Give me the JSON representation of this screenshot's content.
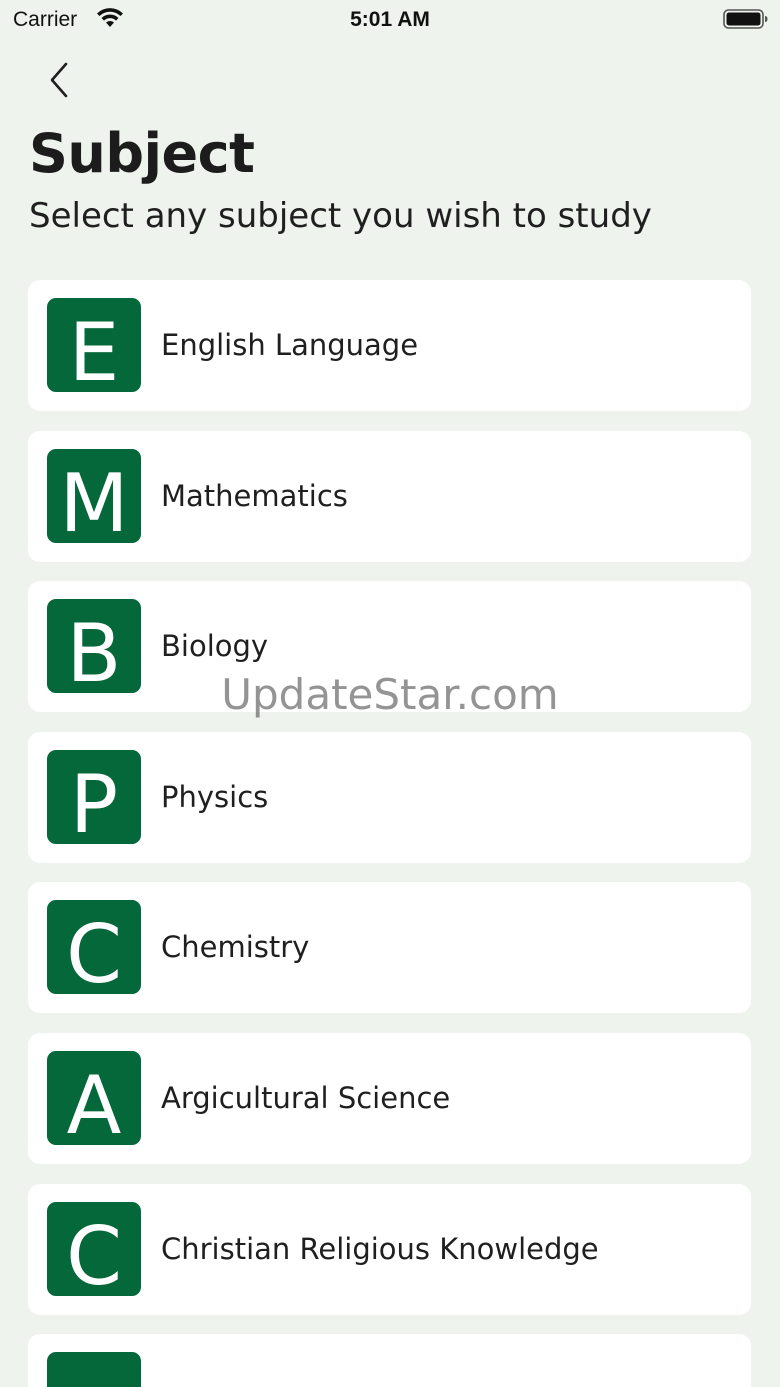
{
  "status_bar": {
    "carrier": "Carrier",
    "time": "5:01 AM"
  },
  "header": {
    "title": "Subject",
    "subtitle": "Select any subject you wish to study"
  },
  "subjects": [
    {
      "initial": "E",
      "label": "English Language"
    },
    {
      "initial": "M",
      "label": "Mathematics"
    },
    {
      "initial": "B",
      "label": "Biology"
    },
    {
      "initial": "P",
      "label": "Physics"
    },
    {
      "initial": "C",
      "label": "Chemistry"
    },
    {
      "initial": "A",
      "label": "Argicultural Science"
    },
    {
      "initial": "C",
      "label": "Christian Religious Knowledge"
    },
    {
      "initial": "",
      "label": ""
    }
  ],
  "watermark": "UpdateStar.com",
  "colors": {
    "background": "#eef3ee",
    "card": "#ffffff",
    "avatar": "#05683a"
  },
  "icons": {
    "back": "chevron-left-icon",
    "wifi": "wifi-icon",
    "battery": "battery-icon"
  }
}
